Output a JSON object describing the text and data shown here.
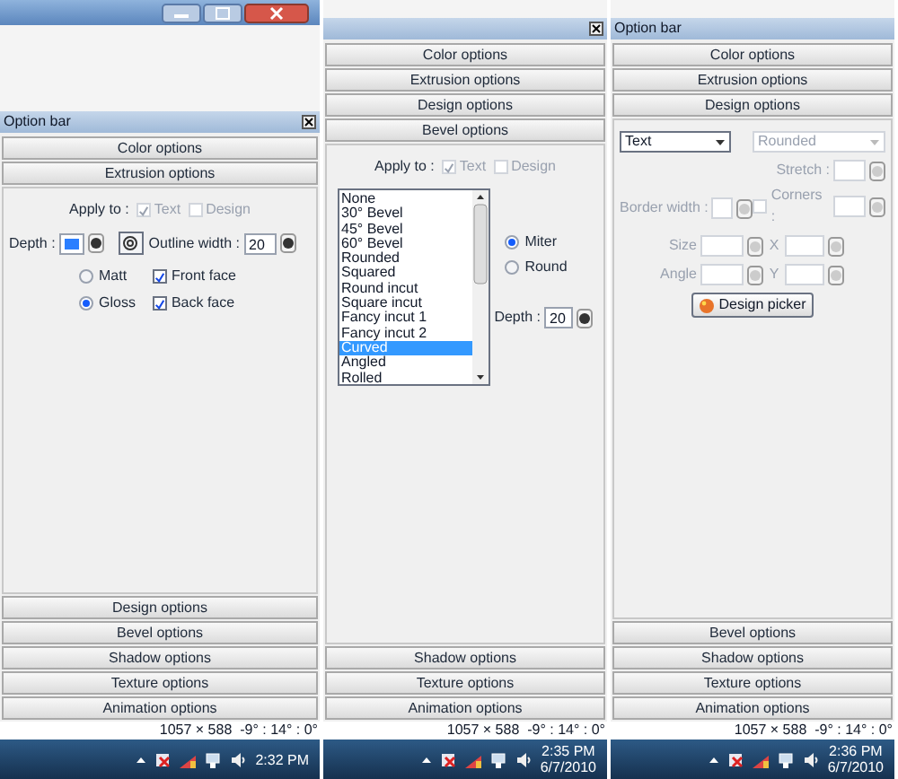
{
  "panels": [
    {
      "window_titlebar": true,
      "option_bar": {
        "title": "Option bar",
        "close": true
      },
      "top_sections": [
        "Color options",
        "Extrusion options"
      ],
      "content": {
        "kind": "extrusion",
        "apply_label": "Apply to :",
        "apply_options": [
          {
            "label": "Text",
            "checked": true
          },
          {
            "label": "Design",
            "checked": false
          }
        ],
        "depth_label": "Depth :",
        "outline_label": "Outline width :",
        "outline_value": "20",
        "finish": [
          {
            "label": "Matt",
            "selected": false
          },
          {
            "label": "Gloss",
            "selected": true
          }
        ],
        "faces": [
          {
            "label": "Front face",
            "checked": true
          },
          {
            "label": "Back face",
            "checked": true
          }
        ]
      },
      "bottom_sections": [
        "Design options",
        "Bevel options",
        "Shadow options",
        "Texture options",
        "Animation options"
      ],
      "status": "1057 × 588  -9° : 14° : 0°",
      "clock": {
        "time": "2:32 PM"
      }
    },
    {
      "window_titlebar": false,
      "option_bar": {
        "close": true
      },
      "top_sections": [
        "Color options",
        "Extrusion options",
        "Design options",
        "Bevel options"
      ],
      "content": {
        "kind": "bevel",
        "apply_label": "Apply to :",
        "apply_options": [
          {
            "label": "Text",
            "checked": true
          },
          {
            "label": "Design",
            "checked": false
          }
        ],
        "bevels": [
          {
            "label": "None",
            "selected": false
          },
          {
            "label": "30° Bevel",
            "selected": false
          },
          {
            "label": "45° Bevel",
            "selected": false
          },
          {
            "label": "60° Bevel",
            "selected": false
          },
          {
            "label": "Rounded",
            "selected": false
          },
          {
            "label": "Squared",
            "selected": false
          },
          {
            "label": "Round incut",
            "selected": false
          },
          {
            "label": "Square incut",
            "selected": false
          },
          {
            "label": "Fancy incut 1",
            "selected": false
          },
          {
            "label": "Fancy incut 2",
            "selected": false
          },
          {
            "label": "Curved",
            "selected": true
          },
          {
            "label": "Angled",
            "selected": false
          },
          {
            "label": "Rolled",
            "selected": false
          }
        ],
        "joins": [
          {
            "label": "Miter",
            "selected": true
          },
          {
            "label": "Round",
            "selected": false
          }
        ],
        "depth_label": "Depth :",
        "depth_value": "20"
      },
      "bottom_sections": [
        "Shadow options",
        "Texture options",
        "Animation options"
      ],
      "status": "1057 × 588  -9° : 14° : 0°",
      "clock": {
        "time": "2:35 PM",
        "date": "6/7/2010"
      }
    },
    {
      "window_titlebar": false,
      "option_bar": {
        "title": "Option bar",
        "close": false
      },
      "top_sections": [
        "Color options",
        "Extrusion options",
        "Design options"
      ],
      "content": {
        "kind": "design",
        "shape_value": "Text",
        "style_value": "Rounded",
        "stretch_label": "Stretch :",
        "border_label": "Border width :",
        "corners": {
          "label": "Corners :",
          "checked": false
        },
        "size_label": "Size",
        "x_label": "X",
        "angle_label": "Angle",
        "y_label": "Y",
        "picker_label": "Design picker"
      },
      "bottom_sections": [
        "Bevel options",
        "Shadow options",
        "Texture options",
        "Animation options"
      ],
      "status": "1057 × 588  -9° : 14° : 0°",
      "clock": {
        "time": "2:36 PM",
        "date": "6/7/2010"
      }
    }
  ]
}
